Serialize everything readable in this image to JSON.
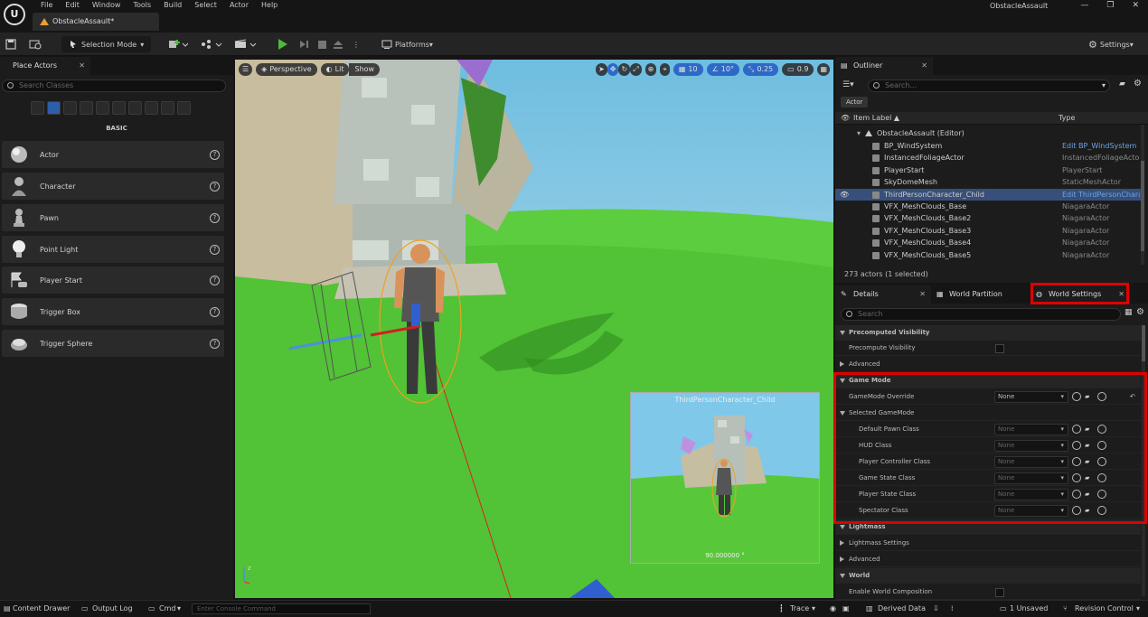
{
  "app": {
    "logo": "U",
    "title": "ObstacleAssault",
    "doc_tab": "ObstacleAssault*",
    "menu": [
      "File",
      "Edit",
      "Window",
      "Tools",
      "Build",
      "Select",
      "Actor",
      "Help"
    ],
    "window_controls": [
      "—",
      "❐",
      "✕"
    ]
  },
  "toolbar": {
    "selection_mode": "Selection Mode",
    "platforms": "Platforms",
    "settings": "Settings"
  },
  "place_actors": {
    "tab": "Place Actors",
    "search_placeholder": "Search Classes",
    "section": "BASIC",
    "items": [
      "Actor",
      "Character",
      "Pawn",
      "Point Light",
      "Player Start",
      "Trigger Box",
      "Trigger Sphere"
    ]
  },
  "viewport": {
    "perspective": "Perspective",
    "lit": "Lit",
    "show": "Show",
    "grid_value": "10",
    "rotation_value": "10°",
    "scale_value": "0.25",
    "camera_speed": "0.9",
    "pip_title": "ThirdPersonCharacter_Child",
    "pip_fov": "90.000000 °"
  },
  "outliner": {
    "tab": "Outliner",
    "search_placeholder": "Search...",
    "filter_chip": "Actor",
    "col_label": "Item Label ▲",
    "col_type": "Type",
    "root": "ObstacleAssault (Editor)",
    "rows": [
      {
        "name": "BP_WindSystem",
        "type": "Edit BP_WindSystem",
        "link": true,
        "selected": false
      },
      {
        "name": "InstancedFoliageActor",
        "type": "InstancedFoliageActor",
        "link": false,
        "selected": false
      },
      {
        "name": "PlayerStart",
        "type": "PlayerStart",
        "link": false,
        "selected": false
      },
      {
        "name": "SkyDomeMesh",
        "type": "StaticMeshActor",
        "link": false,
        "selected": false
      },
      {
        "name": "ThirdPersonCharacter_Child",
        "type": "Edit ThirdPersonChara",
        "link": true,
        "selected": true
      },
      {
        "name": "VFX_MeshClouds_Base",
        "type": "NiagaraActor",
        "link": false,
        "selected": false
      },
      {
        "name": "VFX_MeshClouds_Base2",
        "type": "NiagaraActor",
        "link": false,
        "selected": false
      },
      {
        "name": "VFX_MeshClouds_Base3",
        "type": "NiagaraActor",
        "link": false,
        "selected": false
      },
      {
        "name": "VFX_MeshClouds_Base4",
        "type": "NiagaraActor",
        "link": false,
        "selected": false
      },
      {
        "name": "VFX_MeshClouds_Base5",
        "type": "NiagaraActor",
        "link": false,
        "selected": false
      }
    ],
    "count": "273 actors (1 selected)"
  },
  "details_tabs": {
    "details": "Details",
    "world_partition": "World Partition",
    "world_settings": "World Settings",
    "search_placeholder": "Search"
  },
  "world_settings": {
    "precomputed_visibility": "Precomputed Visibility",
    "precompute_visibility": "Precompute Visibility",
    "advanced": "Advanced",
    "game_mode": "Game Mode",
    "gamemode_override": "GameMode Override",
    "gamemode_override_value": "None",
    "selected_gamemode": "Selected GameMode",
    "class_rows": [
      {
        "label": "Default Pawn Class",
        "value": "None"
      },
      {
        "label": "HUD Class",
        "value": "None"
      },
      {
        "label": "Player Controller Class",
        "value": "None"
      },
      {
        "label": "Game State Class",
        "value": "None"
      },
      {
        "label": "Player State Class",
        "value": "None"
      },
      {
        "label": "Spectator Class",
        "value": "None"
      }
    ],
    "lightmass": "Lightmass",
    "lightmass_settings": "Lightmass Settings",
    "advanced2": "Advanced",
    "world": "World",
    "enable_world_composition": "Enable World Composition"
  },
  "status": {
    "content_drawer": "Content Drawer",
    "output_log": "Output Log",
    "cmd": "Cmd",
    "console_placeholder": "Enter Console Command",
    "trace": "Trace",
    "derived_data": "Derived Data",
    "unsaved": "1 Unsaved",
    "revision_control": "Revision Control"
  }
}
